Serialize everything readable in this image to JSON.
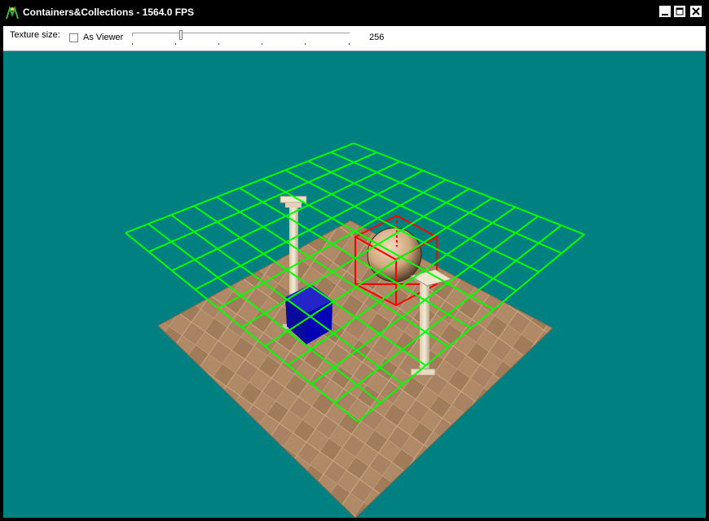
{
  "window": {
    "title": "Containers&Collections - 1564.0 FPS"
  },
  "toolbar": {
    "texture_label": "Texture size:",
    "as_viewer_label": "As Viewer",
    "as_viewer_checked": false,
    "texture_value": "256",
    "slider_fraction": 0.22
  },
  "scene": {
    "background_color": "#008080",
    "grid_color": "#00ff00",
    "bounding_box_color": "#ff0000",
    "floor_color": "#b08a66",
    "cube_color": "#0a0aa0",
    "sphere_color": "#d7b48c",
    "column_color": "#ece0c8"
  },
  "icons": {
    "app": "app-icon",
    "minimize": "minimize-icon",
    "maximize": "maximize-icon",
    "close": "close-icon"
  }
}
